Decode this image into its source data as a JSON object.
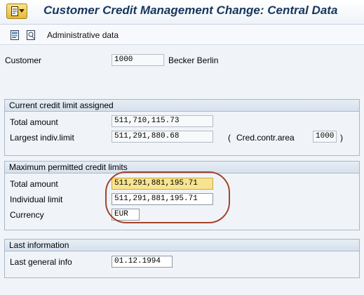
{
  "window": {
    "title": "Customer Credit Management Change: Central Data"
  },
  "toolbar": {
    "admin_label": "Administrative data"
  },
  "customer": {
    "label": "Customer",
    "number": "1000",
    "name": "Becker Berlin"
  },
  "current_limit": {
    "heading": "Current credit limit assigned",
    "total_label": "Total amount",
    "total_value": "511,710,115.73",
    "largest_label": "Largest indiv.limit",
    "largest_value": "511,291,880.68",
    "paren_open": "(",
    "area_label": "Cred.contr.area",
    "area_value": "1000",
    "paren_close": ")"
  },
  "max_limits": {
    "heading": "Maximum permitted credit limits",
    "total_label": "Total amount",
    "total_value": "511,291,881,195.71",
    "individual_label": "Individual limit",
    "individual_value": "511,291,881,195.71",
    "currency_label": "Currency",
    "currency_value": "EUR"
  },
  "last_info": {
    "heading": "Last information",
    "general_label": "Last general info",
    "general_value": "01.12.1994"
  },
  "icons": [
    "app-menu-icon",
    "display-change-icon",
    "other-object-icon"
  ],
  "colors": {
    "title": "#17365d",
    "highlight_field": "#f8e490",
    "annotation_circle": "#a5442c"
  }
}
